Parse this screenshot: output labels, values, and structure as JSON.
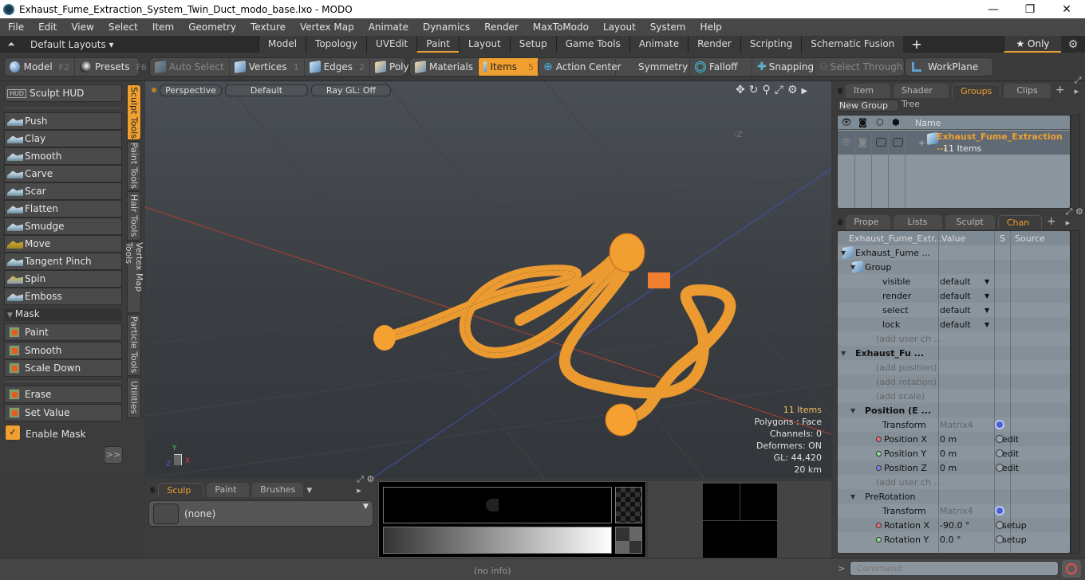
{
  "window": {
    "title": "Exhaust_Fume_Extraction_System_Twin_Duct_modo_base.lxo - MODO",
    "minimize": "—",
    "maximize": "❐",
    "close": "✕"
  },
  "menu": [
    "File",
    "Edit",
    "View",
    "Select",
    "Item",
    "Geometry",
    "Texture",
    "Vertex Map",
    "Animate",
    "Dynamics",
    "Render",
    "MaxToModo",
    "Layout",
    "System",
    "Help"
  ],
  "layouts": {
    "dropdown": "Default Layouts ▾",
    "tabs": [
      "Model",
      "Topology",
      "UVEdit",
      "Paint",
      "Layout",
      "Setup",
      "Game Tools",
      "Animate",
      "Render",
      "Scripting",
      "Schematic Fusion"
    ],
    "active_tab": "Paint",
    "add": "+",
    "only": "★ Only",
    "accent": "#f0a030"
  },
  "toolbar": {
    "model": {
      "label": "Model",
      "key": "F2"
    },
    "presets": {
      "label": "Presets",
      "key": "F6"
    },
    "auto_select": "Auto Select",
    "vertices": {
      "label": "Vertices",
      "key": "1"
    },
    "edges": {
      "label": "Edges",
      "key": "2"
    },
    "polygons": {
      "label": "Polygons"
    },
    "materials": "Materials",
    "items": {
      "label": "Items",
      "key": "5"
    },
    "action_center": "Action Center",
    "symmetry": "Symmetry",
    "falloff": "Falloff",
    "snapping": "Snapping",
    "select_through": "Select Through",
    "workplane": "WorkPlane"
  },
  "left_panel": {
    "sculpt_hud": "Sculpt HUD",
    "tools": [
      "Push",
      "Clay",
      "Smooth",
      "Carve",
      "Scar",
      "Flatten",
      "Smudge",
      "Move",
      "Tangent Pinch",
      "Spin",
      "Emboss"
    ],
    "mask_header": "Mask",
    "mask_tools": [
      "Paint",
      "Smooth",
      "Scale Down"
    ],
    "mask_tools2": [
      "Erase",
      "Set Value"
    ],
    "enable_mask": "Enable Mask",
    "enable_mask_checked": true,
    "more": ">>",
    "vertical_tabs": [
      "Sculpt Tools",
      "Paint Tools",
      "Hair Tools",
      "Vertex Map Tools",
      "Particle Tools",
      "Utilities"
    ],
    "active_vertical_tab": "Sculpt Tools"
  },
  "viewport": {
    "view": "Perspective",
    "shading": "Default",
    "raygl": "Ray GL: Off",
    "axis_label": "-Z",
    "hud": {
      "items": "11 Items",
      "polygons": "Polygons : Face",
      "channels": "Channels: 0",
      "deformers": "Deformers: ON",
      "gl": "GL: 44,420",
      "scale": "20 km"
    },
    "gizmo": {
      "x": "X",
      "y": "Y",
      "z": "Z"
    }
  },
  "groups_panel": {
    "tabs": [
      "Item List",
      "Shader Tree",
      "Groups",
      "Clips"
    ],
    "active_tab": "Groups",
    "new_group": "New Group",
    "name_header": "Name",
    "group_name": "Exhaust_Fume_Extraction ...",
    "group_count": "11 Items"
  },
  "channels_panel": {
    "tabs": [
      "Prope ...",
      "Lists",
      "Sculpt",
      "Chan ..."
    ],
    "active_tab": "Chan ...",
    "headers": {
      "name": "Exhaust_Fume_Extr...",
      "value": "Value",
      "s": "S",
      "source": "Source"
    },
    "rows": [
      {
        "name": "Exhaust_Fume ...",
        "value": "",
        "source": "",
        "kind": "item"
      },
      {
        "name": "Group",
        "value": "",
        "source": "",
        "kind": "group"
      },
      {
        "name": "visible",
        "value": "default",
        "source": "",
        "kind": "dropdown"
      },
      {
        "name": "render",
        "value": "default",
        "source": "",
        "kind": "dropdown"
      },
      {
        "name": "select",
        "value": "default",
        "source": "",
        "kind": "dropdown"
      },
      {
        "name": "lock",
        "value": "default",
        "source": "",
        "kind": "dropdown"
      },
      {
        "name": "(add user ch ...",
        "value": "",
        "source": "",
        "kind": "add"
      },
      {
        "name": "Exhaust_Fu ...",
        "value": "",
        "source": "",
        "kind": "locator"
      },
      {
        "name": "(add position)",
        "value": "",
        "source": "",
        "kind": "add"
      },
      {
        "name": "(add rotation)",
        "value": "",
        "source": "",
        "kind": "add"
      },
      {
        "name": "(add scale)",
        "value": "",
        "source": "",
        "kind": "add"
      },
      {
        "name": "Position (E ...",
        "value": "",
        "source": "",
        "kind": "xform"
      },
      {
        "name": "Transform",
        "value": "Matrix4",
        "source": "",
        "kind": "matrix"
      },
      {
        "name": "Position X",
        "value": "0 m",
        "source": "edit",
        "kind": "x"
      },
      {
        "name": "Position Y",
        "value": "0 m",
        "source": "edit",
        "kind": "y"
      },
      {
        "name": "Position Z",
        "value": "0 m",
        "source": "edit",
        "kind": "z"
      },
      {
        "name": "(add user ch ...",
        "value": "",
        "source": "",
        "kind": "add"
      },
      {
        "name": "PreRotation",
        "value": "",
        "source": "",
        "kind": "xform2"
      },
      {
        "name": "Transform",
        "value": "Matrix4",
        "source": "",
        "kind": "matrix"
      },
      {
        "name": "Rotation X",
        "value": "-90.0 °",
        "source": "setup",
        "kind": "x"
      },
      {
        "name": "Rotation Y",
        "value": "0.0 °",
        "source": "setup",
        "kind": "y"
      }
    ]
  },
  "bottom_panel": {
    "tabs": [
      "Sculp ...",
      "Paint ...",
      "Brushes"
    ],
    "active_tab": "Sculp ...",
    "preset": "(none)"
  },
  "status": {
    "info": "(no info)",
    "command_placeholder": "Command",
    "prompt": ">"
  }
}
